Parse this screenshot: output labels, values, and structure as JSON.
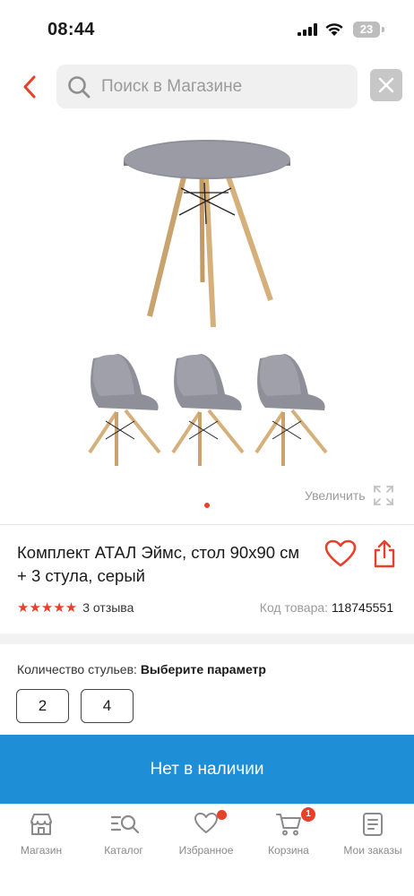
{
  "status_bar": {
    "time": "08:44",
    "battery": "23"
  },
  "header": {
    "search_placeholder": "Поиск в Магазине",
    "back_icon": "chevron-left-icon",
    "clear_icon": "close-icon"
  },
  "gallery": {
    "zoom_label": "Увеличить",
    "slide_count": 1,
    "active_slide": 1
  },
  "product": {
    "title": "Комплект АТАЛ Эймс, стол 90х90 см + 3 стула, серый",
    "rating": 5,
    "stars": "★★★★★",
    "reviews": "3 отзыва",
    "sku_label": "Код товара: ",
    "sku_value": "118745551"
  },
  "options": {
    "label": "Количество стульев: ",
    "value": "Выберите параметр",
    "choices": [
      "2",
      "4"
    ]
  },
  "cta": {
    "label": "Нет в наличии"
  },
  "tabbar": {
    "items": [
      {
        "label": "Магазин",
        "icon": "store-icon"
      },
      {
        "label": "Каталог",
        "icon": "catalog-search-icon"
      },
      {
        "label": "Избранное",
        "icon": "heart-icon"
      },
      {
        "label": "Корзина",
        "icon": "cart-icon",
        "badge": "1"
      },
      {
        "label": "Мои заказы",
        "icon": "orders-icon"
      }
    ]
  },
  "colors": {
    "accent": "#e8402a",
    "cta_blue": "#1e8fd6",
    "muted": "#9a9a9a"
  }
}
